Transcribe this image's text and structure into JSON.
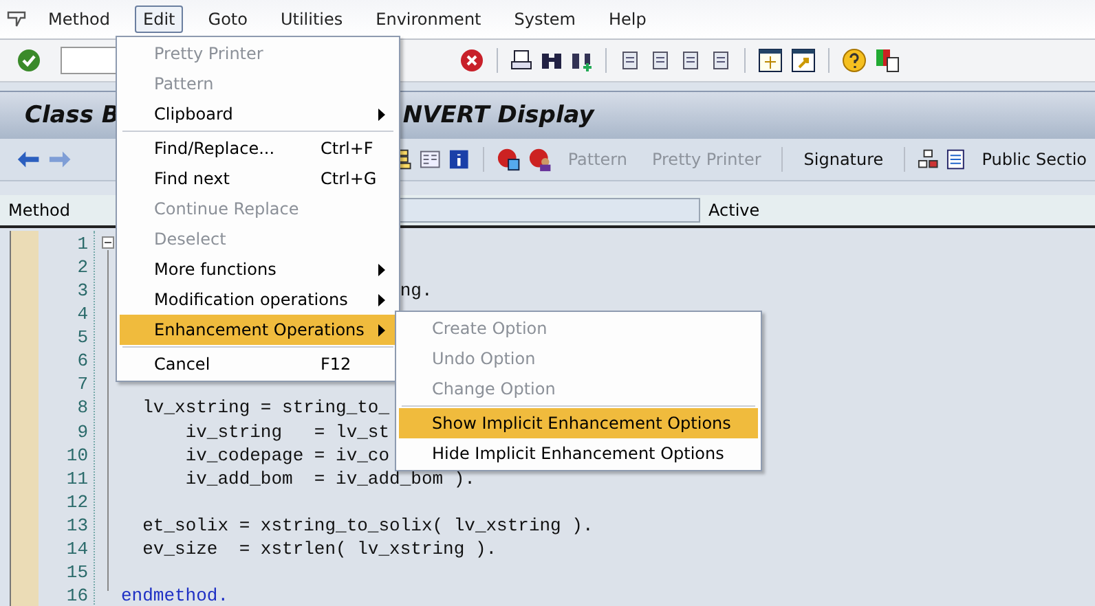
{
  "menu_bar": [
    {
      "label": "Method",
      "selected": false
    },
    {
      "label": "Edit",
      "selected": true
    },
    {
      "label": "Goto",
      "selected": false
    },
    {
      "label": "Utilities",
      "selected": false
    },
    {
      "label": "Environment",
      "selected": false
    },
    {
      "label": "System",
      "selected": false
    },
    {
      "label": "Help",
      "selected": false
    }
  ],
  "title_bar": {
    "title_start": "Class B",
    "title_end": "NVERT Display"
  },
  "app_toolbar": {
    "buttons": [
      {
        "label": "Pattern",
        "disabled": true
      },
      {
        "label": "Pretty Printer",
        "disabled": true
      },
      {
        "label": "Signature",
        "disabled": false
      },
      {
        "label": "Public Sectio",
        "disabled": false
      }
    ]
  },
  "method_row": {
    "label": "Method",
    "status": "Active"
  },
  "editor": {
    "lines": [
      {
        "number": "1"
      },
      {
        "number": "2"
      },
      {
        "number": "3",
        "text": "                          ng."
      },
      {
        "number": "4"
      },
      {
        "number": "5"
      },
      {
        "number": "6"
      },
      {
        "number": "7"
      },
      {
        "number": "8",
        "text": "  lv_xstring = string_to_"
      },
      {
        "number": "9",
        "text": "      iv_string   = lv_st"
      },
      {
        "number": "10",
        "text": "      iv_codepage = iv_co"
      },
      {
        "number": "11",
        "text": "      iv_add_bom  = iv_add_bom )."
      },
      {
        "number": "12"
      },
      {
        "number": "13",
        "text": "  et_solix = xstring_to_solix( lv_xstring )."
      },
      {
        "number": "14",
        "text": "  ev_size  = xstrlen( lv_xstring )."
      },
      {
        "number": "15"
      },
      {
        "number": "16",
        "text": "endmethod.",
        "kind": "keyword"
      }
    ]
  },
  "edit_menu": {
    "groups": [
      [
        {
          "label": "Pretty Printer",
          "disabled": true,
          "submenu": false,
          "selected": false
        },
        {
          "label": "Pattern",
          "disabled": true,
          "submenu": false,
          "selected": false
        },
        {
          "label": "Clipboard",
          "disabled": false,
          "submenu": true,
          "selected": false
        }
      ],
      [
        {
          "label": "Find/Replace...",
          "shortcut": "Ctrl+F",
          "disabled": false,
          "submenu": false,
          "selected": false
        },
        {
          "label": "Find next",
          "shortcut": "Ctrl+G",
          "disabled": false,
          "submenu": false,
          "selected": false
        },
        {
          "label": "Continue Replace",
          "disabled": true,
          "submenu": false,
          "selected": false
        },
        {
          "label": "Deselect",
          "disabled": true,
          "submenu": false,
          "selected": false
        },
        {
          "label": "More functions",
          "disabled": false,
          "submenu": true,
          "selected": false
        },
        {
          "label": "Modification operations",
          "disabled": false,
          "submenu": true,
          "selected": false
        },
        {
          "label": "Enhancement Operations",
          "disabled": false,
          "submenu": true,
          "selected": true
        }
      ],
      [
        {
          "label": "Cancel",
          "shortcut": "F12",
          "disabled": false,
          "submenu": false,
          "selected": false
        }
      ]
    ]
  },
  "enhancement_submenu": {
    "groups": [
      [
        {
          "label": "Create Option",
          "disabled": true,
          "selected": false
        },
        {
          "label": "Undo Option",
          "disabled": true,
          "selected": false
        },
        {
          "label": "Change Option",
          "disabled": true,
          "selected": false
        }
      ],
      [
        {
          "label": "Show Implicit Enhancement Options",
          "disabled": false,
          "selected": true
        },
        {
          "label": "Hide Implicit Enhancement Options",
          "disabled": false,
          "selected": false
        }
      ]
    ]
  }
}
